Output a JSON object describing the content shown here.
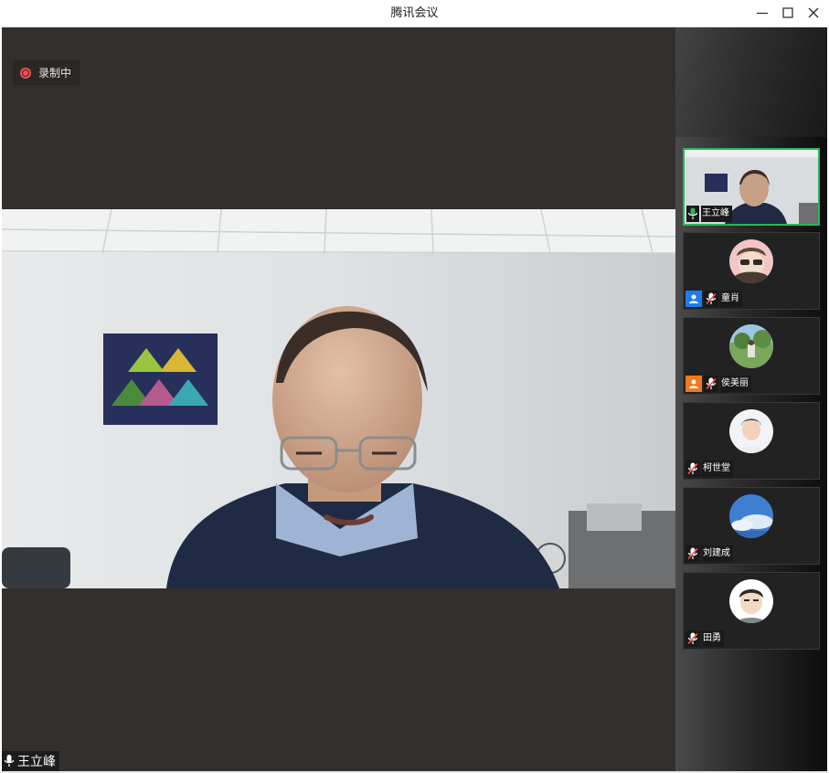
{
  "window": {
    "title": "腾讯会议",
    "minimize_icon": "minimize-icon",
    "maximize_icon": "maximize-icon",
    "close_icon": "close-icon"
  },
  "main": {
    "recording_label": "录制中",
    "speaker_name": "王立峰"
  },
  "participants": [
    {
      "name": "王立峰",
      "mic": "on",
      "role": "",
      "avatar": "video-thumbnail",
      "active": true
    },
    {
      "name": "童肖",
      "mic": "muted",
      "role": "host",
      "avatar": "cartoon-girl-avatar",
      "active": false
    },
    {
      "name": "侯美丽",
      "mic": "muted",
      "role": "co-host",
      "avatar": "outdoor-photo-avatar",
      "active": false
    },
    {
      "name": "柯世堂",
      "mic": "muted",
      "role": "",
      "avatar": "portrait-photo-avatar",
      "active": false
    },
    {
      "name": "刘建成",
      "mic": "muted",
      "role": "",
      "avatar": "sky-photo-avatar",
      "active": false
    },
    {
      "name": "田勇",
      "mic": "muted",
      "role": "",
      "avatar": "cartoon-boy-avatar",
      "active": false
    }
  ],
  "colors": {
    "main_bg": "#322f2d",
    "active_border": "#2bb55a",
    "recording": "#ff4d4f",
    "host_badge": "#1c7cf0",
    "cohost_badge": "#f07a1c",
    "mic_muted": "#ff4d4f",
    "mic_on": "#2bb55a"
  }
}
